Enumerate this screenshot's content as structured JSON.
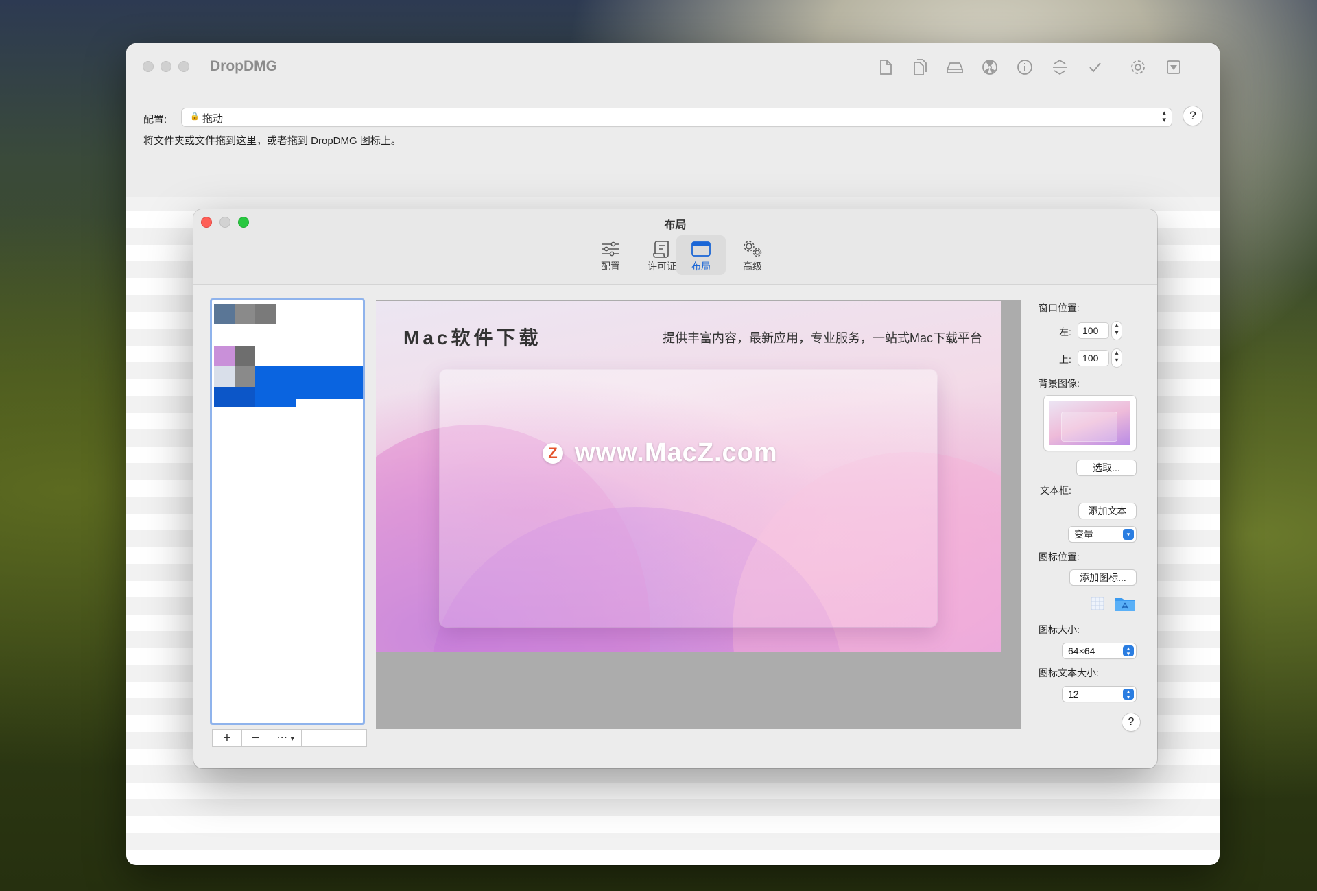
{
  "app": {
    "title": "DropDMG",
    "toolbar_icons": [
      "document-icon",
      "documents-icon",
      "disk-icon",
      "radiation-icon",
      "info-icon",
      "levels-icon",
      "checkmark-icon",
      "gear-icon",
      "eject-icon"
    ]
  },
  "config": {
    "label": "配置:",
    "selected": "拖动",
    "hint": "将文件夹或文件拖到这里，或者拖到 DropDMG 图标上。",
    "help": "?"
  },
  "dialog": {
    "title": "布局",
    "tabs": [
      {
        "label": "配置",
        "icon": "sliders-icon"
      },
      {
        "label": "许可证",
        "icon": "scroll-icon"
      },
      {
        "label": "布局",
        "icon": "window-icon",
        "active": true
      },
      {
        "label": "高级",
        "icon": "gears-icon"
      }
    ],
    "list_buttons": {
      "add": "+",
      "remove": "−",
      "more": "⋯"
    },
    "preview": {
      "title": "Mac软件下载",
      "subtitle": "提供丰富内容，最新应用，专业服务，一站式Mac下载平台",
      "watermark": "www.MacZ.com",
      "watermark_badge": "Z"
    },
    "sidebar": {
      "window_pos_label": "窗口位置:",
      "left_label": "左:",
      "left_value": "100",
      "top_label": "上:",
      "top_value": "100",
      "bg_image_label": "背景图像:",
      "choose_button": "选取...",
      "textbox_label": "文本框:",
      "add_text_button": "添加文本",
      "variable_popup": "变量",
      "icon_pos_label": "图标位置:",
      "add_icon_button": "添加图标...",
      "icon_size_label": "图标大小:",
      "icon_size_value": "64×64",
      "icon_text_size_label": "图标文本大小:",
      "icon_text_size_value": "12",
      "help": "?"
    },
    "colors": {
      "accent": "#1a66d6",
      "selection": "#0a64e0",
      "close": "#fe5f57",
      "min": "#d2d2d2",
      "max": "#28c840"
    }
  }
}
